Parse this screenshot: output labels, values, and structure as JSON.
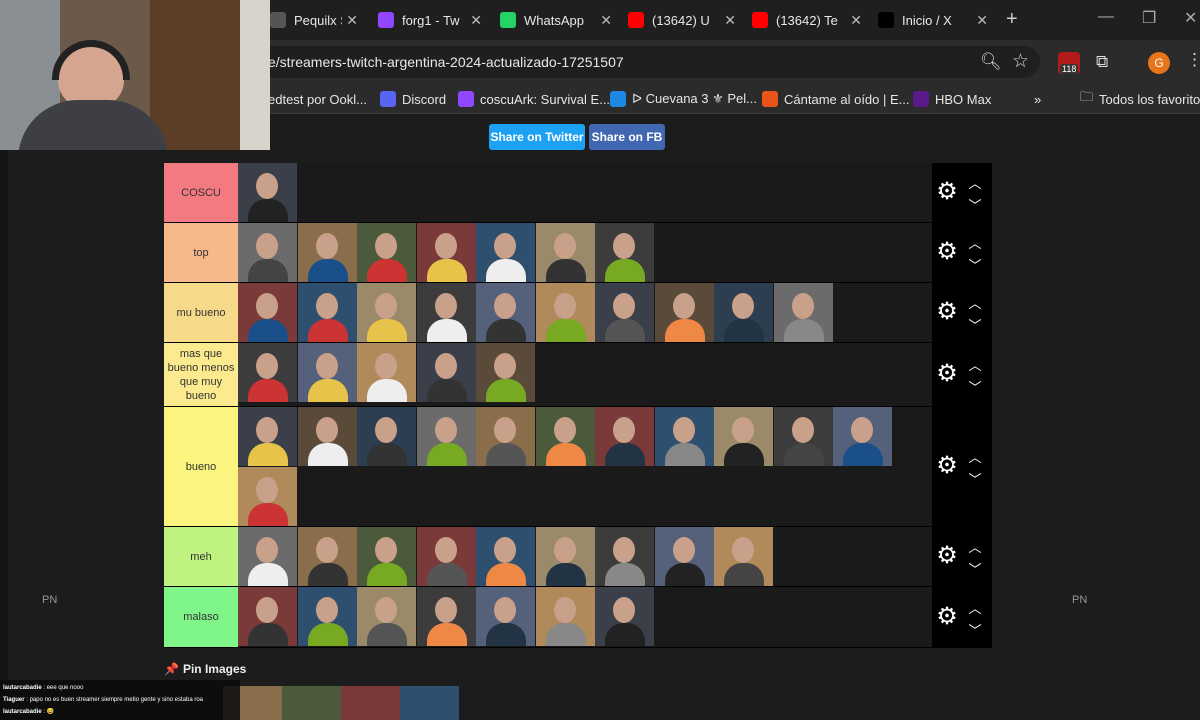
{
  "browser": {
    "tabs": [
      {
        "title": "Pequilx St",
        "icon": "generic-icon",
        "color": "#555555"
      },
      {
        "title": "forg1 - Tw",
        "icon": "twitch-icon",
        "color": "#9146ff"
      },
      {
        "title": "WhatsApp",
        "icon": "whatsapp-icon",
        "color": "#25d366"
      },
      {
        "title": "(13642) U",
        "icon": "youtube-icon",
        "color": "#ff0000"
      },
      {
        "title": "(13642) Te",
        "icon": "youtube-icon",
        "color": "#ff0000"
      },
      {
        "title": "Inicio / X",
        "icon": "x-icon",
        "color": "#000000"
      }
    ],
    "url": "e/streamers-twitch-argentina-2024-actualizado-17251507",
    "extensions_badge": "118",
    "profile_initial": "G",
    "bookmarks": [
      {
        "label": "edtest por Ookl...",
        "icon": "",
        "color": "#2b2b2b"
      },
      {
        "label": "Discord",
        "icon": "discord-icon",
        "color": "#5865f2"
      },
      {
        "label": "coscuArk: Survival E...",
        "icon": "twitch-icon",
        "color": "#9146ff"
      },
      {
        "label": "ᐅ Cuevana 3 ⚜ Pel...",
        "icon": "cuevana-icon",
        "color": "#1e88e5"
      },
      {
        "label": "Cántame al oído | E...",
        "icon": "w-icon",
        "color": "#e8551b"
      },
      {
        "label": "HBO Max",
        "icon": "hbo-icon",
        "color": "#5a1a8a"
      }
    ],
    "bookmarks_more": "»",
    "all_bookmarks": "Todos los favoritos"
  },
  "page": {
    "share_twitter": "Share on Twitter",
    "share_fb": "Share on FB",
    "colors": {
      "twitter": "#1da1f2",
      "fb": "#4267b2"
    },
    "side_left": "PN",
    "side_right": "PN",
    "pin_images": "Pin Images"
  },
  "tiers": [
    {
      "label": "COSCU",
      "color": "#f27a80",
      "count": 1
    },
    {
      "label": "top",
      "color": "#f7b98a",
      "count": 7
    },
    {
      "label": "mu bueno",
      "color": "#f7d98a",
      "count": 10
    },
    {
      "label": "mas que bueno menos que muy bueno",
      "color": "#fbea8e",
      "count": 5
    },
    {
      "label": "bueno",
      "color": "#fbf57f",
      "count": 12
    },
    {
      "label": "meh",
      "color": "#bff27f",
      "count": 9
    },
    {
      "label": "malaso",
      "color": "#7ff58a",
      "count": 7
    }
  ],
  "chat": {
    "messages": [
      {
        "user": "lautarcabadie",
        "text": "eee que nooo"
      },
      {
        "user": "Tiaguer",
        "text": "papo no es buen streamer siempre metio gente y sino estaba roa"
      },
      {
        "user": "lautarcabadie",
        "text": "😅"
      }
    ]
  }
}
